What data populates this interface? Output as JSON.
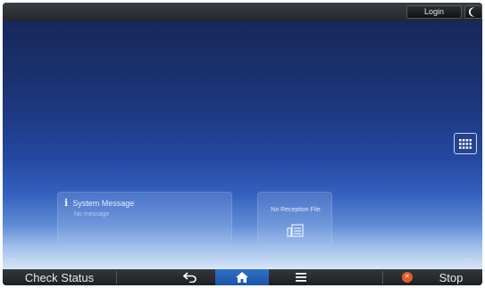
{
  "topbar": {
    "login_label": "Login",
    "energy_icon": "moon-icon"
  },
  "main": {
    "keypad_icon": "keypad-icon",
    "system_message": {
      "icon": "info-icon",
      "title": "System Message",
      "message": "No message"
    },
    "reception": {
      "label": "No Reception File",
      "icon": "fax-icon"
    },
    "page_indicator_left": "..",
    "page_indicator_right": ".."
  },
  "bottombar": {
    "check_status_label": "Check Status",
    "back_icon": "back-arrow-icon",
    "home_icon": "home-icon",
    "menu_icon": "menu-icon",
    "stop_icon": "stop-icon",
    "stop_label": "Stop"
  },
  "colors": {
    "home_active": "#1f5eb4",
    "stop_accent": "#e45a2a"
  }
}
